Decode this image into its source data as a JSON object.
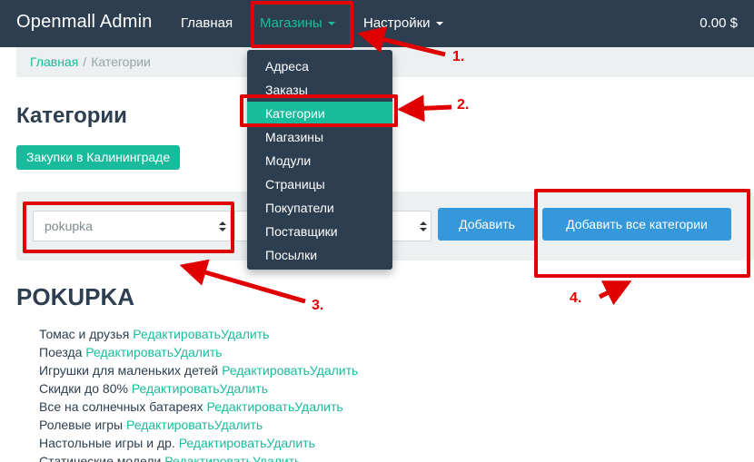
{
  "navbar": {
    "brand": "Openmall Admin",
    "items": [
      {
        "label": "Главная"
      },
      {
        "label": "Магазины"
      },
      {
        "label": "Настройки"
      }
    ],
    "cart_total": "0.00 $",
    "colors": {
      "bg": "#2c3e50",
      "accent": "#18bc9c"
    }
  },
  "breadcrumb": {
    "home": "Главная",
    "separator": "/",
    "current": "Категории"
  },
  "page": {
    "title": "Категории",
    "shop_button": "Закупки в Калининграде"
  },
  "form": {
    "select_source": "pokupka",
    "select_target": "",
    "add_button": "Добавить",
    "add_all_button": "Добавить все категории"
  },
  "dropdown": {
    "items": [
      "Адреса",
      "Заказы",
      "Категории",
      "Магазины",
      "Модули",
      "Страницы",
      "Покупатели",
      "Поставщики",
      "Посылки"
    ],
    "active_index": 2
  },
  "section": {
    "title": "POKUPKA",
    "edit_label": "Редактировать",
    "delete_label": "Удалить",
    "categories": [
      "Томас и друзья",
      "Поезда",
      "Игрушки для маленьких детей",
      "Скидки до 80%",
      "Все на солнечных батареях",
      "Ролевые игры",
      "Настольные игры и др.",
      "Статические модели"
    ]
  },
  "annotations": {
    "labels": [
      "1.",
      "2.",
      "3.",
      "4."
    ],
    "color": "#e00000"
  }
}
